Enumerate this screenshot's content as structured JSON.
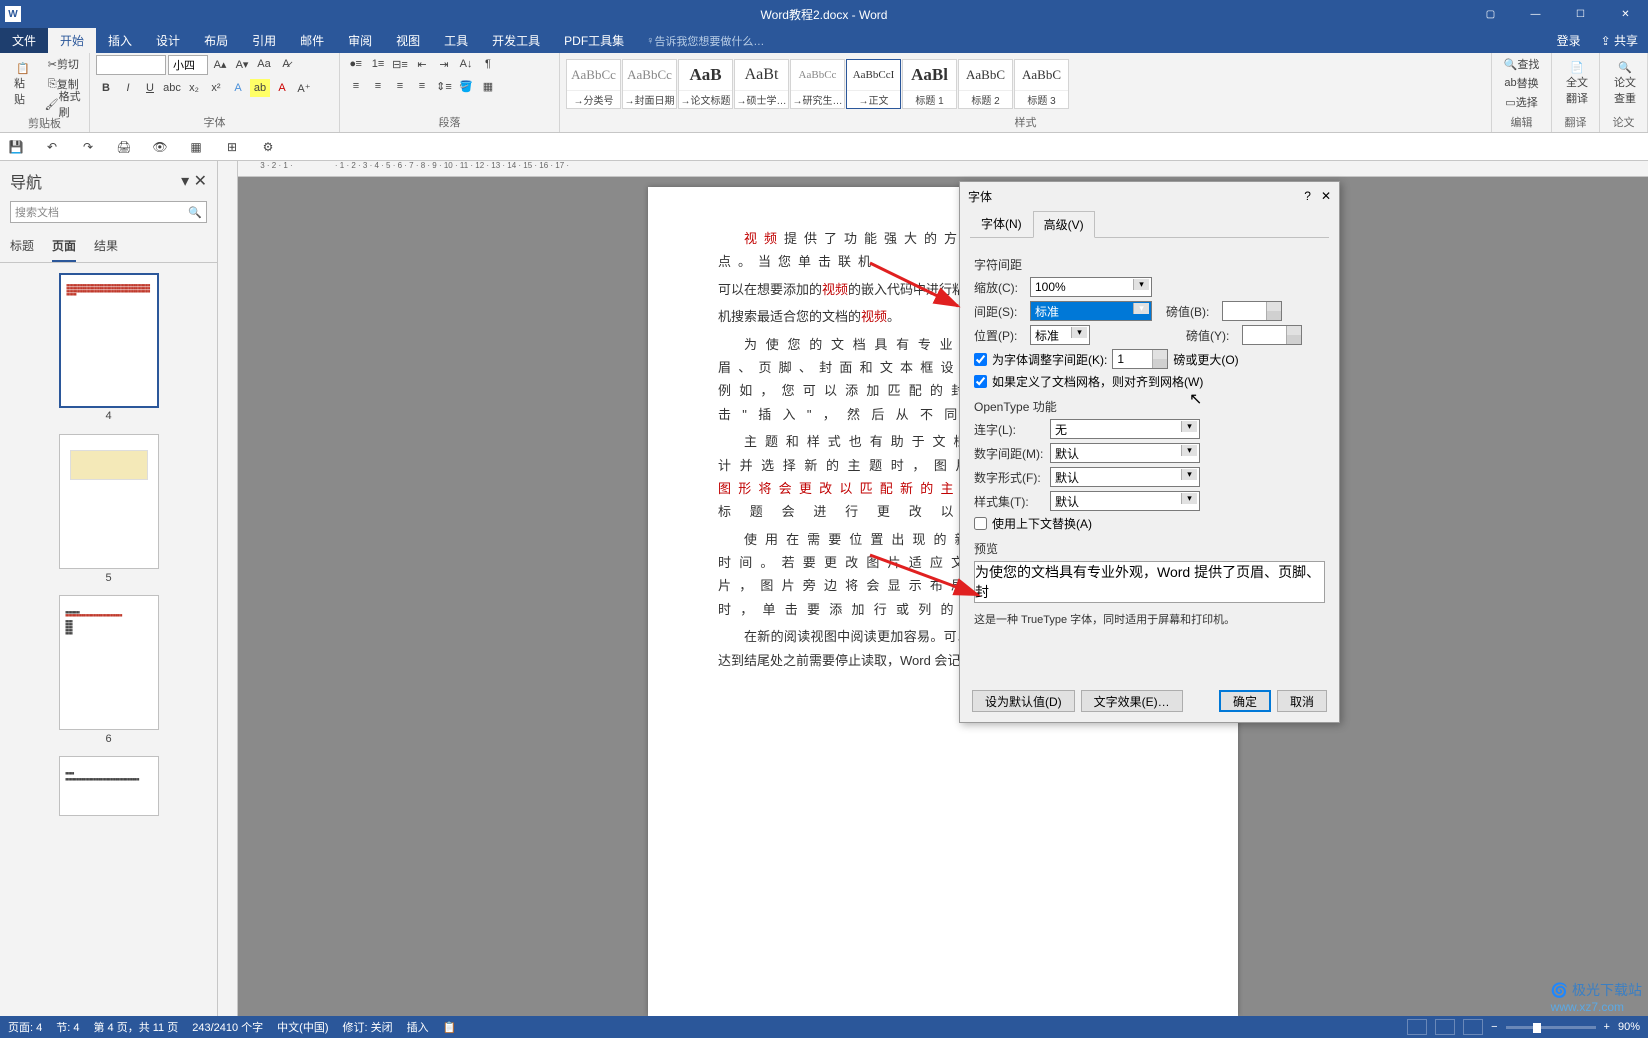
{
  "titlebar": {
    "title": "Word教程2.docx - Word"
  },
  "ribbon_tabs": {
    "file": "文件",
    "tabs": [
      "开始",
      "插入",
      "设计",
      "布局",
      "引用",
      "邮件",
      "审阅",
      "视图",
      "工具",
      "开发工具",
      "PDF工具集"
    ],
    "active_index": 0,
    "tell_me": "告诉我您想要做什么…",
    "right": {
      "login": "登录",
      "share": "共享"
    }
  },
  "ribbon": {
    "clipboard": {
      "label": "剪贴板",
      "paste": "粘贴",
      "cut": "剪切",
      "copy": "复制",
      "format_painter": "格式刷"
    },
    "font": {
      "label": "字体",
      "font_name": "",
      "font_size": "小四"
    },
    "paragraph": {
      "label": "段落"
    },
    "styles": {
      "label": "样式",
      "items": [
        {
          "preview": "AaBbCc",
          "label": "→分类号"
        },
        {
          "preview": "AaBbCc",
          "label": "→封面日期"
        },
        {
          "preview": "AaB",
          "label": "→论文标题"
        },
        {
          "preview": "AaBt",
          "label": "→硕士学…"
        },
        {
          "preview": "AaBbCc",
          "label": "→研究生…"
        },
        {
          "preview": "AaBbCcI",
          "label": "→正文"
        },
        {
          "preview": "AaBl",
          "label": "标题 1"
        },
        {
          "preview": "AaBbC",
          "label": "标题 2"
        },
        {
          "preview": "AaBbC",
          "label": "标题 3"
        }
      ],
      "selected_index": 5
    },
    "editing": {
      "label": "编辑",
      "find": "查找",
      "replace": "替换",
      "select": "选择"
    },
    "translate": {
      "label": "翻译",
      "btn": "全文\n翻译"
    },
    "thesis": {
      "label": "论文",
      "btn": "论文\n查重"
    }
  },
  "nav": {
    "title": "导航",
    "search_placeholder": "搜索文档",
    "modes": [
      "标题",
      "页面",
      "结果"
    ],
    "active_mode": 1,
    "thumbs": [
      4,
      5,
      6
    ],
    "selected_thumb": 0
  },
  "document": {
    "text_parts": {
      "p1_a": "视频",
      "p1_b": "提供了功能强大的方法帮助您证明您的观点。当您单击联机",
      "p2_a": "可以在想要添加的",
      "p2_b": "视频",
      "p2_c": "的嵌入代码中进行粘贴。您也可以键入一个关",
      "p3_a": "机搜索最适合您的文档的",
      "p3_b": "视频",
      "p4": "为使您的文档具有专业外观，Word 提供了页眉、页脚、封面和文本框设计，这些设计互为补充。例如，您可以添加匹配的封面、页眉和提要栏。单击\"插入\"，然后从不同库中选择所需元素。",
      "p5": "主题和样式也有助于文档保持协调。当您单击设计并选择新的主题时，图片、图表或 ",
      "p5_b": "SmartArt 图形将会更改以匹配新的主题",
      "p5_c": "。当应用样式时，您的标题会进行更改以匹配新的主题。",
      "p6": "使用在需要位置出现的新按钮在 Word 中保存时间。若要更改图片适应文档的方式，请单击该图片，图片旁边将会显示布局选项按钮。当处理表格时，单击要添加行或列的位置，然后单击加号。",
      "p7": "在新的阅读视图中阅读更加容易。可以折叠文档某些部分并关注本。如果在达到结尾处之前需要停止读取，Word 会记住您的停止位置在另一个设备上。"
    }
  },
  "dialog": {
    "title": "字体",
    "tabs": [
      "字体(N)",
      "高级(V)"
    ],
    "active_tab": 1,
    "char_spacing": {
      "section": "字符间距",
      "scale_lbl": "缩放(C):",
      "scale": "100%",
      "spacing_lbl": "间距(S):",
      "spacing": "标准",
      "spacing_val_lbl": "磅值(B):",
      "spacing_val": "",
      "position_lbl": "位置(P):",
      "position": "标准",
      "position_val_lbl": "磅值(Y):",
      "position_val": "",
      "kerning_lbl": "为字体调整字间距(K):",
      "kerning_val": "1",
      "kerning_unit": "磅或更大(O)",
      "snap_lbl": "如果定义了文档网格，则对齐到网格(W)"
    },
    "opentype": {
      "section": "OpenType 功能",
      "ligatures_lbl": "连字(L):",
      "ligatures": "无",
      "num_spacing_lbl": "数字间距(M):",
      "num_spacing": "默认",
      "num_form_lbl": "数字形式(F):",
      "num_form": "默认",
      "styleset_lbl": "样式集(T):",
      "styleset": "默认",
      "contextual_lbl": "使用上下文替换(A)"
    },
    "preview": {
      "section": "预览",
      "text": "为使您的文档具有专业外观，Word 提供了页眉、页脚、封",
      "desc": "这是一种 TrueType 字体，同时适用于屏幕和打印机。"
    },
    "buttons": {
      "default": "设为默认值(D)",
      "effects": "文字效果(E)…",
      "ok": "确定",
      "cancel": "取消"
    }
  },
  "statusbar": {
    "page": "页面: 4",
    "section": "节: 4",
    "page_of": "第 4 页，共 11 页",
    "words": "243/2410 个字",
    "lang": "中文(中国)",
    "track": "修订: 关闭",
    "insert": "插入",
    "zoom": "90%"
  },
  "watermark": {
    "cn": "极光下载站",
    "url": "www.xz7.com"
  }
}
